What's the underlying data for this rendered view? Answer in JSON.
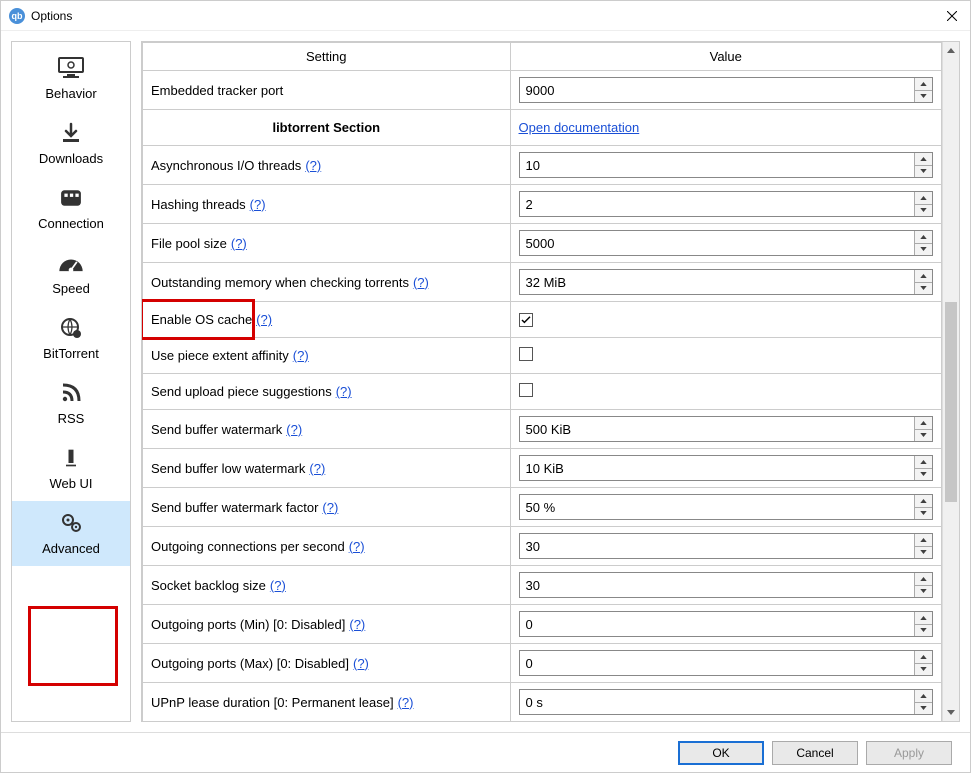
{
  "window": {
    "title": "Options"
  },
  "sidebar": {
    "items": [
      {
        "label": "Behavior"
      },
      {
        "label": "Downloads"
      },
      {
        "label": "Connection"
      },
      {
        "label": "Speed"
      },
      {
        "label": "BitTorrent"
      },
      {
        "label": "RSS"
      },
      {
        "label": "Web UI"
      },
      {
        "label": "Advanced"
      }
    ]
  },
  "table": {
    "headers": {
      "setting": "Setting",
      "value": "Value"
    },
    "section_label": "libtorrent Section",
    "doc_link": "Open documentation",
    "help_token": "(?)",
    "rows": [
      {
        "label": "Embedded tracker port",
        "type": "spin",
        "value": "9000",
        "help": false
      },
      {
        "label": "Asynchronous I/O threads",
        "type": "spin",
        "value": "10",
        "help": true
      },
      {
        "label": "Hashing threads",
        "type": "spin",
        "value": "2",
        "help": true
      },
      {
        "label": "File pool size",
        "type": "spin",
        "value": "5000",
        "help": true
      },
      {
        "label": "Outstanding memory when checking torrents",
        "type": "spin",
        "value": "32 MiB",
        "help": true
      },
      {
        "label": "Enable OS cache",
        "type": "check",
        "checked": true,
        "help": true,
        "highlight": true
      },
      {
        "label": "Use piece extent affinity",
        "type": "check",
        "checked": false,
        "help": true
      },
      {
        "label": "Send upload piece suggestions",
        "type": "check",
        "checked": false,
        "help": true
      },
      {
        "label": "Send buffer watermark",
        "type": "spin",
        "value": "500 KiB",
        "help": true
      },
      {
        "label": "Send buffer low watermark",
        "type": "spin",
        "value": "10 KiB",
        "help": true
      },
      {
        "label": "Send buffer watermark factor",
        "type": "spin",
        "value": "50 %",
        "help": true
      },
      {
        "label": "Outgoing connections per second",
        "type": "spin",
        "value": "30",
        "help": true
      },
      {
        "label": "Socket backlog size",
        "type": "spin",
        "value": "30",
        "help": true
      },
      {
        "label": "Outgoing ports (Min) [0: Disabled]",
        "type": "spin",
        "value": "0",
        "help": true
      },
      {
        "label": "Outgoing ports (Max) [0: Disabled]",
        "type": "spin",
        "value": "0",
        "help": true
      },
      {
        "label": "UPnP lease duration [0: Permanent lease]",
        "type": "spin",
        "value": "0 s",
        "help": true
      }
    ]
  },
  "footer": {
    "ok": "OK",
    "cancel": "Cancel",
    "apply": "Apply"
  }
}
